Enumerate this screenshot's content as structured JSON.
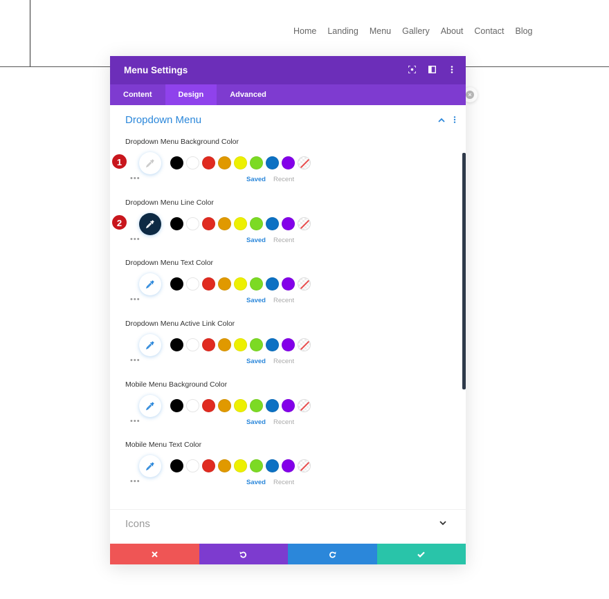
{
  "site": {
    "nav": [
      "Home",
      "Landing",
      "Menu",
      "Gallery",
      "About",
      "Contact",
      "Blog"
    ]
  },
  "modal": {
    "title": "Menu Settings",
    "header_icons": [
      "focus-icon",
      "split-view-icon",
      "more-vertical-icon"
    ],
    "tabs": [
      {
        "label": "Content",
        "active": false
      },
      {
        "label": "Design",
        "active": true
      },
      {
        "label": "Advanced",
        "active": false
      }
    ],
    "section": {
      "title": "Dropdown Menu",
      "expanded": true
    },
    "fields": [
      {
        "label": "Dropdown Menu Background Color",
        "badge": "1",
        "picker_state": "empty"
      },
      {
        "label": "Dropdown Menu Line Color",
        "badge": "2",
        "picker_state": "set"
      },
      {
        "label": "Dropdown Menu Text Color",
        "badge": "",
        "picker_state": "default"
      },
      {
        "label": "Dropdown Menu Active Link Color",
        "badge": "",
        "picker_state": "default"
      },
      {
        "label": "Mobile Menu Background Color",
        "badge": "",
        "picker_state": "default"
      },
      {
        "label": "Mobile Menu Text Color",
        "badge": "",
        "picker_state": "default"
      }
    ],
    "palette": [
      "#000000",
      "#ffffff",
      "#e02b20",
      "#e09900",
      "#edf000",
      "#7cda24",
      "#0c71c3",
      "#8300e9"
    ],
    "saved_label": "Saved",
    "recent_label": "Recent",
    "collapsed_section": {
      "title": "Icons"
    },
    "footer_icons": [
      "close-icon",
      "undo-icon",
      "redo-icon",
      "check-icon"
    ]
  },
  "colors": {
    "header": "#6c2eb9",
    "tabs": "#7e3bd0",
    "tab_active": "#8f42ec",
    "accent": "#2b87da",
    "set_color": "#0d2a44",
    "badge": "#c8161d",
    "footer_cancel": "#ef5555",
    "footer_undo": "#7d3bcf",
    "footer_redo": "#2b87da",
    "footer_save": "#29c4a9"
  }
}
